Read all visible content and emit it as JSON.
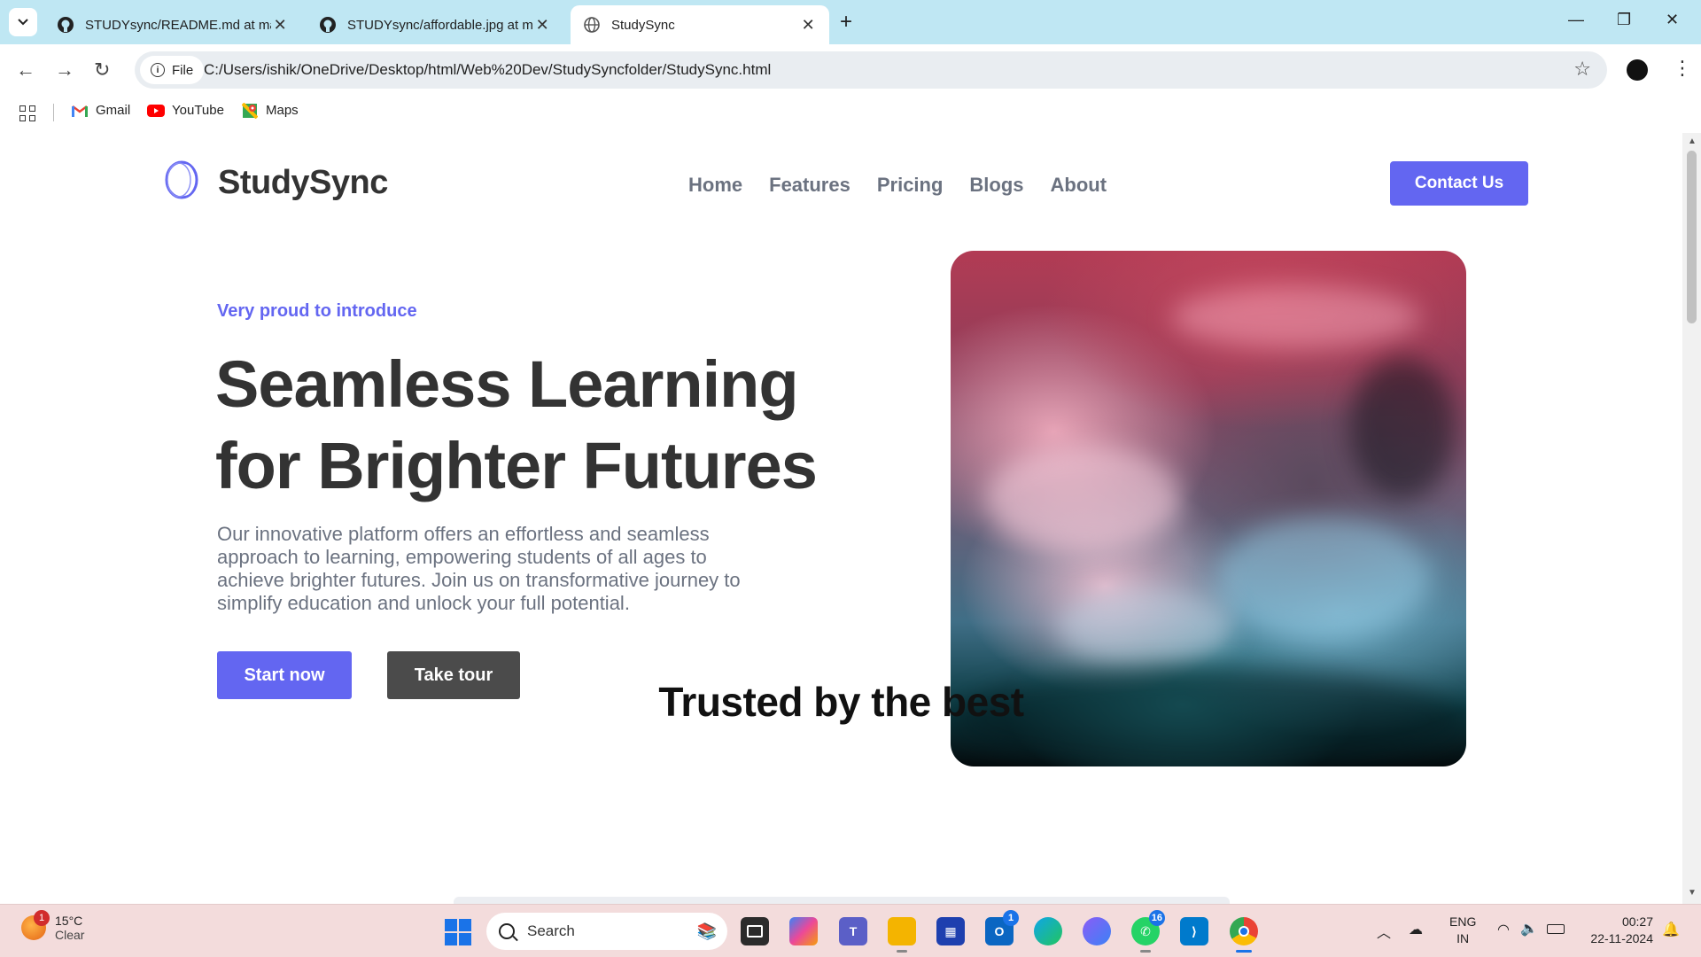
{
  "browser": {
    "tabs": [
      {
        "title": "STUDYsync/README.md at main",
        "icon": "github-icon",
        "active": false
      },
      {
        "title": "STUDYsync/affordable.jpg at main",
        "icon": "github-icon",
        "active": false
      },
      {
        "title": "StudySync",
        "icon": "globe-icon",
        "active": true
      }
    ],
    "new_tab": "+",
    "address": {
      "chip": "File",
      "url": "C:/Users/ishik/OneDrive/Desktop/html/Web%20Dev/StudySyncfolder/StudySync.html"
    },
    "bookmarks": [
      {
        "label": "Gmail",
        "icon": "gmail-icon"
      },
      {
        "label": "YouTube",
        "icon": "youtube-icon"
      },
      {
        "label": "Maps",
        "icon": "maps-icon"
      }
    ]
  },
  "site": {
    "brand": "StudySync",
    "nav": [
      "Home",
      "Features",
      "Pricing",
      "Blogs",
      "About"
    ],
    "contact_label": "Contact Us",
    "hero": {
      "eyebrow": "Very proud to introduce",
      "headline_line1": "Seamless Learning",
      "headline_line2": "for Brighter Futures",
      "lead": "Our innovative platform offers an effortless and seamless approach to learning, empowering students of all ages to achieve brighter futures. Join us on transformative journey to simplify education and unlock your full potential.",
      "primary_cta": "Start now",
      "secondary_cta": "Take tour"
    },
    "trusted_title": "Trusted by the best",
    "accent_color": "#6366f1"
  },
  "taskbar": {
    "weather": {
      "temp": "15°C",
      "condition": "Clear",
      "badge": "1"
    },
    "search_placeholder": "Search",
    "badges": {
      "outlook": "1",
      "whatsapp": "16"
    },
    "language": {
      "line1": "ENG",
      "line2": "IN"
    },
    "clock": {
      "time": "00:27",
      "date": "22-11-2024"
    }
  }
}
